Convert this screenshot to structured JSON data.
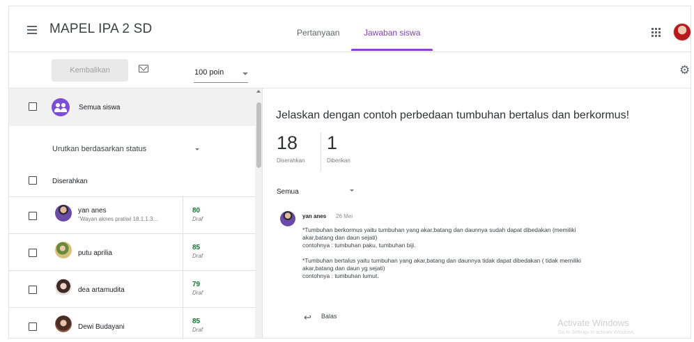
{
  "header": {
    "title": "MAPEL IPA 2 SD",
    "tabs": [
      {
        "label": "Pertanyaan"
      },
      {
        "label": "Jawaban siswa"
      }
    ]
  },
  "toolbar": {
    "return_label": "Kembalikan",
    "points": "100 poin"
  },
  "students_panel": {
    "all_label": "Semua siswa",
    "sort_label": "Urutkan berdasarkan status",
    "submitted_group": "Diserahkan",
    "students": [
      {
        "name": "yan anes",
        "preview": "\"Wayan aknes pratiwi 18.1.1.3...",
        "grade": "80",
        "status": "Draf"
      },
      {
        "name": "putu aprilia",
        "preview": "",
        "grade": "85",
        "status": "Draf"
      },
      {
        "name": "dea artamudita",
        "preview": "",
        "grade": "79",
        "status": "Draf"
      },
      {
        "name": "Dewi Budayani",
        "preview": "",
        "grade": "85",
        "status": "Draf"
      }
    ]
  },
  "question_panel": {
    "question": "Jelaskan dengan contoh perbedaan tumbuhan bertalus dan berkormus!",
    "submitted_count": "18",
    "submitted_label": "Diserahkan",
    "given_count": "1",
    "given_label": "Diberikan",
    "filter": "Semua",
    "answer": {
      "author": "yan anes",
      "date": "26 Mei",
      "lines": [
        "*Tumbuhan berkormus yaitu tumbuhan yang akar,batang dan daunnya sudah dapat dibedakan (memiliki",
        "akar,batang dan daun sejati)",
        "contohnya : tumbuhan paku, tumbuhan biji.",
        "",
        "*Tumbuhan bertalus yaitu tumbuhan yang akar,batang dan daunnya tidak dapat dibedakan (  tidak memiliki",
        "akar,batang dan daun yg sejati)",
        "contohnya : tumbuhan lumut."
      ],
      "reply_label": "Balas"
    }
  },
  "watermark": {
    "title": "Activate Windows",
    "subtitle": "Go to Settings to activate Windows."
  },
  "colors": {
    "accent_purple": "#7e3fb8",
    "grade_green": "#137333"
  }
}
